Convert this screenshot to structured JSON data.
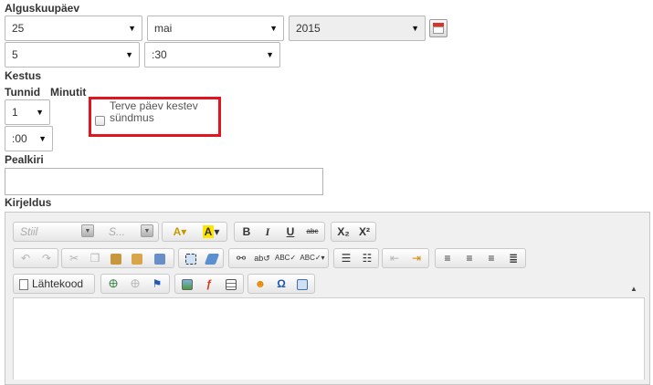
{
  "start_date": {
    "label": "Alguskuupäev",
    "day": "25",
    "month": "mai",
    "year": "2015",
    "hour": "5",
    "minute": ":30"
  },
  "duration": {
    "label": "Kestus",
    "hours_label": "Tunnid",
    "minutes_label": "Minutit",
    "hours": "1",
    "minutes": ":00",
    "all_day_label": "Terve päev kestev sündmus"
  },
  "title_field": {
    "label": "Pealkiri",
    "value": ""
  },
  "description": {
    "label": "Kirjeldus",
    "style_placeholder": "Stiil",
    "size_placeholder": "S...",
    "toolbar": {
      "bold": "B",
      "italic": "I",
      "underline": "U",
      "strike": "abc",
      "subscript": "X₂",
      "superscript": "X²",
      "source_label": "Lähtekood"
    }
  },
  "icons": {
    "calendar": "calendar-icon",
    "dropdown": "▼"
  }
}
